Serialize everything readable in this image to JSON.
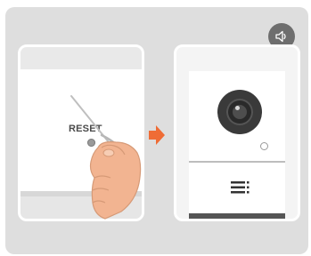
{
  "reset_label": "RESET",
  "colors": {
    "background": "#dedede",
    "panel": "#ffffff",
    "arrow": "#ef6c35",
    "sound_button": "#6e6e6e",
    "camera": "#3a3a3a"
  },
  "icons": {
    "sound": "speaker-icon",
    "arrow": "arrow-right-icon",
    "menu": "speaker-grille-icon"
  }
}
